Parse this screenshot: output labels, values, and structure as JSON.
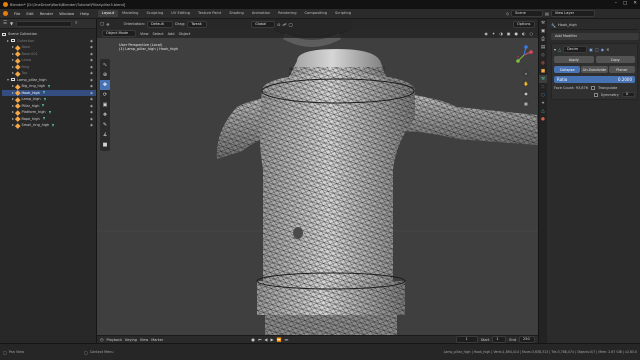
{
  "window": {
    "title": "Blender* [D:\\OneDrive\\Work\\Blender\\Tutorial\\Pillar\\pillar3.blend]",
    "controls": [
      "–",
      "□",
      "✕"
    ]
  },
  "menu": {
    "items": [
      "File",
      "Edit",
      "Render",
      "Window",
      "Help"
    ],
    "workspaces": [
      "Layout",
      "Modeling",
      "Sculpting",
      "UV Editing",
      "Texture Paint",
      "Shading",
      "Animation",
      "Rendering",
      "Compositing",
      "Scripting"
    ],
    "active_workspace": "Layout",
    "scene_label": "Scene",
    "view_layer_label": "View Layer"
  },
  "outliner": {
    "search_placeholder": "",
    "root": "Scene Collection",
    "rows": [
      {
        "label": "Collection",
        "dim": true,
        "indent": 1,
        "kind": "coll"
      },
      {
        "label": "Base",
        "dim": true,
        "indent": 2,
        "kind": "mesh"
      },
      {
        "label": "Base.001",
        "dim": true,
        "indent": 2,
        "kind": "mesh"
      },
      {
        "label": "Lamp",
        "dim": true,
        "indent": 2,
        "kind": "mesh"
      },
      {
        "label": "Ring",
        "dim": true,
        "indent": 2,
        "kind": "mesh"
      },
      {
        "label": "Top",
        "dim": true,
        "indent": 2,
        "kind": "mesh"
      },
      {
        "label": "Lamp_pillar_high",
        "dim": false,
        "indent": 1,
        "kind": "coll"
      },
      {
        "label": "Big_ring_high",
        "dim": false,
        "indent": 2,
        "kind": "mesh"
      },
      {
        "label": "Hook_high",
        "dim": false,
        "indent": 2,
        "kind": "mesh",
        "selected": true
      },
      {
        "label": "Lamp_high",
        "dim": false,
        "indent": 2,
        "kind": "mesh"
      },
      {
        "label": "Pillar_high",
        "dim": false,
        "indent": 2,
        "kind": "mesh"
      },
      {
        "label": "Platform_high",
        "dim": false,
        "indent": 2,
        "kind": "mesh"
      },
      {
        "label": "Rope_high",
        "dim": false,
        "indent": 2,
        "kind": "mesh"
      },
      {
        "label": "Small_ring_high",
        "dim": false,
        "indent": 2,
        "kind": "mesh"
      }
    ]
  },
  "viewport": {
    "mode": "Object Mode",
    "menus": [
      "View",
      "Select",
      "Add",
      "Object"
    ],
    "orientation_label": "Orientation:",
    "orientation_value": "Default",
    "drag_label": "Drag:",
    "drag_value": "Tweak",
    "transform_space": "Global",
    "options_label": "Options",
    "info_line1": "User Perspective (Local)",
    "info_line2": "(1) Lamp_pillar_high | Hook_high",
    "tools": [
      "select",
      "cursor",
      "move",
      "rotate",
      "scale",
      "transform",
      "annotate",
      "measure",
      "add-cube"
    ]
  },
  "timeline": {
    "playback": "Playback",
    "keying": "Keying",
    "view": "View",
    "marker": "Marker",
    "current_frame": "1",
    "start_label": "Start",
    "start": "1",
    "end_label": "End",
    "end": "250"
  },
  "properties": {
    "object_name": "Hook_high",
    "add_modifier": "Add Modifier",
    "modifier_name": "Decim",
    "apply": "Apply",
    "copy": "Copy",
    "tabs": [
      "Collapse",
      "Un-Subdivide",
      "Planar"
    ],
    "ratio_label": "Ratio",
    "ratio_value": "0.2000",
    "face_count": "Face Count: 93,876",
    "triangulate": "Triangulate",
    "symmetry": "Symmetry",
    "symmetry_axis": "X",
    "tab_icons": [
      "tool",
      "render",
      "output",
      "view-layer",
      "scene",
      "world",
      "object",
      "modifier",
      "particles",
      "physics",
      "constraints",
      "data",
      "material"
    ]
  },
  "status": {
    "left": "Pan View",
    "middle": "Context Menu",
    "right": "Lamp_pillar_high | Hook_high | Verts:1,894,414 | Faces:3,638,313 | Tris:3,788,474 | Objects:0/7 | Mem: 2.67 GiB | v2.83.0"
  },
  "colors": {
    "accent": "#4772b3",
    "select_row": "#334d80",
    "mesh_icon": "#f5a646",
    "modifier_icon": "#5bc3a8",
    "blender_logo": "#e87d0d"
  }
}
